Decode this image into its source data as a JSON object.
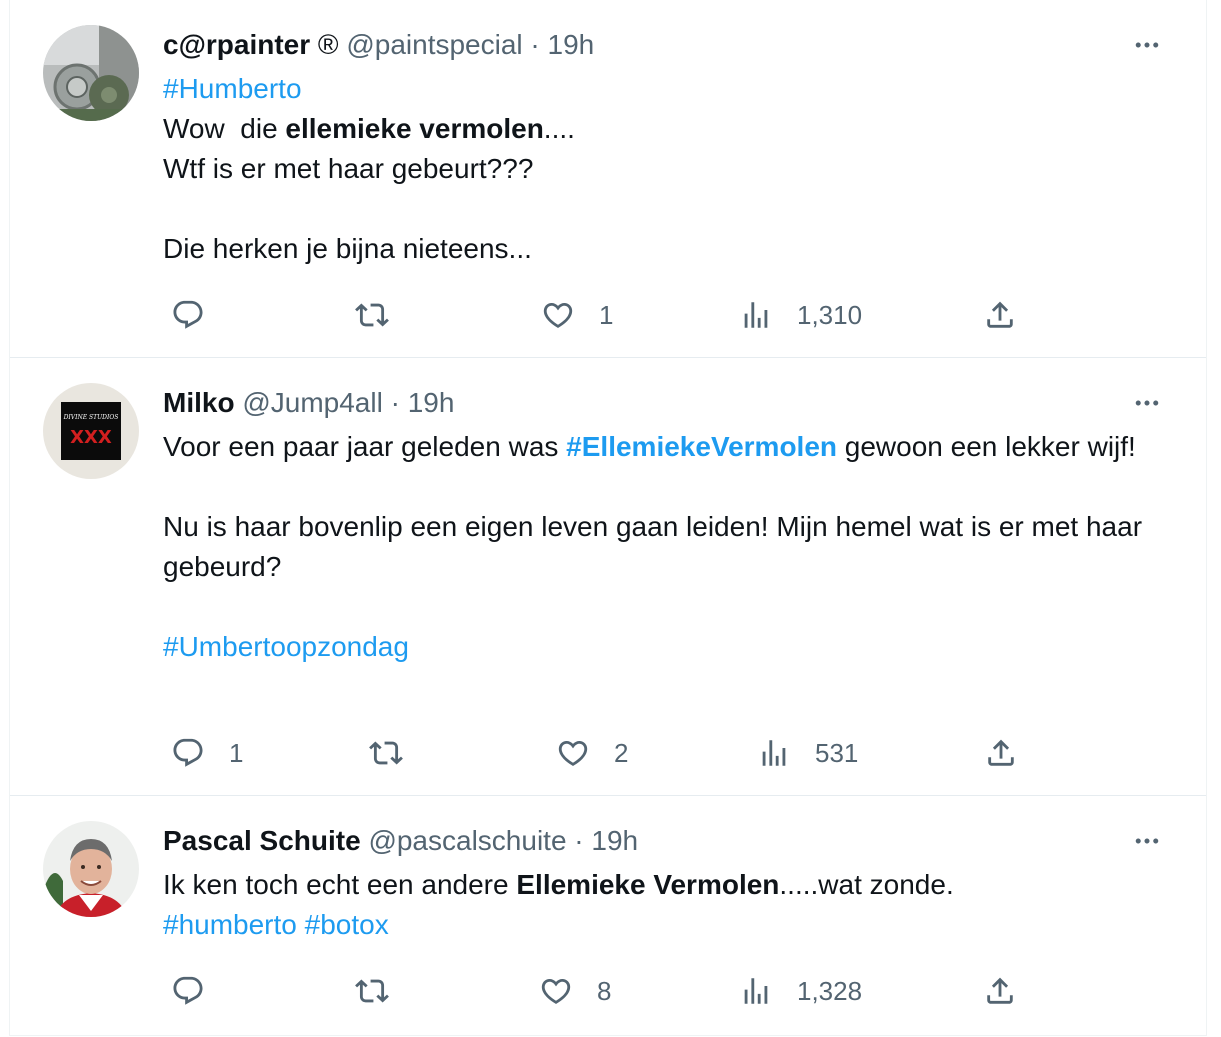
{
  "tweets": [
    {
      "name": "c@rpainter",
      "badge": "®",
      "handle": "@paintspecial",
      "separator": "·",
      "time": "19h",
      "hashtag_top": "#Humberto",
      "line1_pre": "Wow  die ",
      "line1_bold": "ellemieke vermolen",
      "line1_post": "....",
      "line2": "Wtf is er met haar gebeurt???",
      "line3": "Die herken je bijna nieteens...",
      "replies": "",
      "retweets": "",
      "likes": "1",
      "views": "1,310"
    },
    {
      "name": "Milko",
      "handle": "@Jump4all",
      "separator": "·",
      "time": "19h",
      "avatar_text": "DIVINE STUDIOS",
      "line1_pre": "Voor een paar jaar geleden was ",
      "line1_hashtag": "#EllemiekeVermolen",
      "line1_post": " gewoon een lekker wijf!",
      "line2": "Nu is haar bovenlip een eigen leven gaan leiden! Mijn hemel wat is er met haar gebeurd?",
      "hashtag_bottom": "#Umbertoopzondag",
      "replies": "1",
      "retweets": "",
      "likes": "2",
      "views": "531"
    },
    {
      "name": "Pascal Schuite",
      "handle": "@pascalschuite",
      "separator": "·",
      "time": "19h",
      "line1_pre": "Ik ken toch echt een andere ",
      "line1_bold": "Ellemieke Vermolen",
      "line1_post": ".....wat zonde.",
      "hashtag_a": "#humberto",
      "hashtag_b": "#botox",
      "replies": "",
      "retweets": "",
      "likes": "8",
      "views": "1,328"
    }
  ],
  "icons": {
    "reply": "reply-icon",
    "retweet": "retweet-icon",
    "like": "like-icon",
    "views": "views-icon",
    "share": "share-icon",
    "more": "more-icon"
  },
  "colors": {
    "link": "#1d9bf0",
    "text": "#0f1419",
    "secondary": "#536471",
    "divider": "#e6ecf0"
  }
}
